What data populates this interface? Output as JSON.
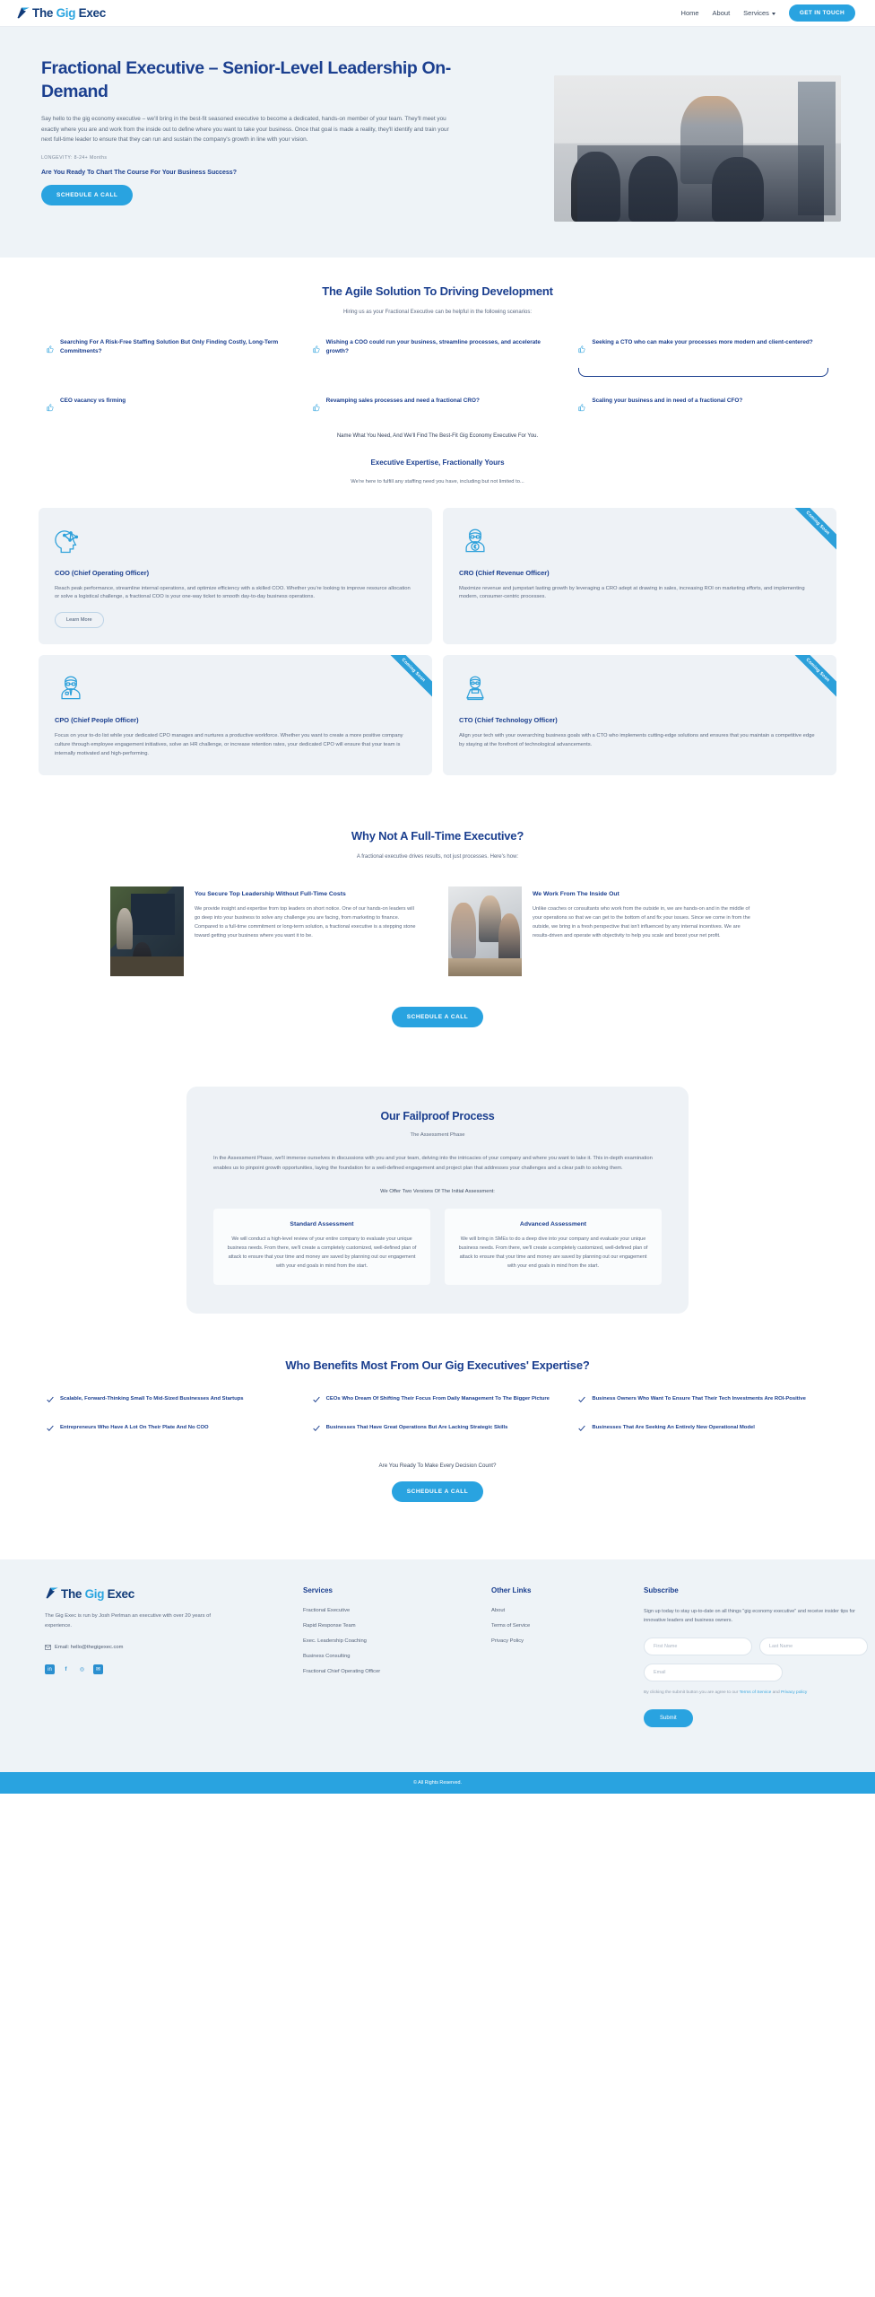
{
  "header": {
    "logo": {
      "part1": "The ",
      "part2": "Gig ",
      "part3": "Exec"
    },
    "nav": [
      {
        "label": "Home"
      },
      {
        "label": "About"
      },
      {
        "label": "Services"
      }
    ],
    "cta_label": "GET IN TOUCH"
  },
  "hero": {
    "title": "Fractional Executive – Senior-Level Leadership On-Demand",
    "paragraph": "Say hello to the gig economy executive – we'll bring in the best-fit seasoned executive to become a dedicated, hands-on member of your team. They'll meet you exactly where you are and work from the inside out to define where you want to take your business. Once that goal is made a reality, they'll identify and train your next full-time leader to ensure that they can run and sustain the company's growth in line with your vision.",
    "longevity": "LONGEVITY: 8-24+ Months",
    "cta_question": "Are You Ready To Chart The Course For Your Business Success?",
    "cta_label": "SCHEDULE A CALL"
  },
  "agile": {
    "title": "The Agile Solution To Driving Development",
    "subtitle": "Hiring us as your Fractional Executive can be helpful in the following scenarios:",
    "scenarios": [
      "Searching For A Risk-Free Staffing Solution But Only Finding Costly, Long-Term Commitments?",
      "Wishing a COO could run your business, streamline processes, and accelerate growth?",
      "Seeking a CTO who can make your processes more modern and client-centered?",
      "CEO vacancy vs firming",
      "Revamping sales processes and need a fractional CRO?",
      "Scaling your business and in need of a fractional CFO?"
    ],
    "tagline": "Name What You Need, And We'll Find The Best-Fit Gig Economy Executive For You.",
    "tagline2": "Executive Expertise, Fractionally Yours",
    "tagline3": "We're here to fulfill any staffing need you have, including but not limited to..."
  },
  "exec_cards": [
    {
      "icon": "head-network-icon",
      "title": "COO (Chief Operating Officer)",
      "desc": "Reach peak performance, streamline internal operations, and optimize efficiency with a skilled COO. Whether you're looking to improve resource allocation or solve a logistical challenge, a fractional COO is your one-way ticket to smooth day-to-day business operations.",
      "button": "Learn More",
      "ribbon": ""
    },
    {
      "icon": "person-revenue-icon",
      "title": "CRO (Chief Revenue Officer)",
      "desc": "Maximize revenue and jumpstart lasting growth by leveraging a CRO adept at drawing in sales, increasing ROI on marketing efforts, and implementing modern, consumer-centric processes.",
      "button": "",
      "ribbon": "Coming Soon"
    },
    {
      "icon": "person-tie-icon",
      "title": "CPO (Chief People Officer)",
      "desc": "Focus on your to-do list while your dedicated CPO manages and nurtures a productive workforce. Whether you want to create a more positive company culture through employee engagement initiatives, solve an HR challenge, or increase retention rates, your dedicated CPO will ensure that your team is internally motivated and high-performing.",
      "button": "",
      "ribbon": "Coming Soon"
    },
    {
      "icon": "person-laptop-icon",
      "title": "CTO (Chief Technology Officer)",
      "desc": "Align your tech with your overarching business goals with a CTO who implements cutting-edge solutions and ensures that you maintain a competitive edge by staying at the forefront of technological advancements.",
      "button": "",
      "ribbon": "Coming Soon"
    }
  ],
  "why": {
    "title": "Why Not A Full-Time Executive?",
    "subtitle": "A fractional executive drives results, not just processes. Here's how:",
    "items": [
      {
        "title": "You Secure Top Leadership Without Full-Time Costs",
        "text": "We provide insight and expertise from top leaders on short notice. One of our hands-on leaders will go deep into your business to solve any challenge you are facing, from marketing to finance. Compared to a full-time commitment or long-term solution, a fractional executive is a stepping stone toward getting your business where you want it to be."
      },
      {
        "title": "We Work From The Inside Out",
        "text": "Unlike coaches or consultants who work from the outside in, we are hands-on and in the middle of your operations so that we can get to the bottom of and fix your issues. Since we come in from the outside, we bring in a fresh perspective that isn't influenced by any internal incentives. We are results-driven and operate with objectivity to help you scale and boost your net profit."
      }
    ],
    "cta_label": "SCHEDULE A CALL"
  },
  "process": {
    "title": "Our Failproof Process",
    "subtitle": "The Assessment Phase",
    "paragraph": "In the Assessment Phase, we'll immerse ourselves in discussions with you and your team, delving into the intricacies of your company and where you want to take it. This in-depth examination enables us to pinpoint growth opportunities, laying the foundation for a well-defined engagement and project plan that addresses your challenges and a clear path to solving them.",
    "offer": "We Offer Two Versions Of The Initial Assessment:",
    "assessments": [
      {
        "title": "Standard Assessment",
        "text": "We will conduct a high-level review of your entire company to evaluate your unique business needs. From there, we'll create a completely customized, well-defined plan of attack to ensure that your time and money are saved by planning out our engagement with your end goals in mind from the start."
      },
      {
        "title": "Advanced Assessment",
        "text": "We will bring in SMEs to do a deep dive into your company and evaluate your unique business needs. From there, we'll create a completely customized, well-defined plan of attack to ensure that your time and money are saved by planning out our engagement with your end goals in mind from the start."
      }
    ]
  },
  "benefits": {
    "title": "Who Benefits Most From Our Gig Executives' Expertise?",
    "items": [
      "Scalable, Forward-Thinking Small To Mid-Sized Businesses And Startups",
      "CEOs Who Dream Of Shifting Their Focus From Daily Management To The Bigger Picture",
      "Business Owners Who Want To Ensure That Their Tech Investments Are ROI-Positive",
      "Entrepreneurs Who Have A Lot On Their Plate And No COO",
      "Businesses That Have Great Operations But Are Lacking Strategic Skills",
      "Businesses That Are Seeking An Entirely New Operational Model"
    ],
    "question": "Are You Ready To Make Every Decision Count?",
    "cta_label": "SCHEDULE A CALL"
  },
  "footer": {
    "logo": {
      "part1": "The ",
      "part2": "Gig ",
      "part3": "Exec"
    },
    "about": "The Gig Exec is run by Josh Perlman an executive with over 20 years of experience.",
    "email_label": "Email: hello@thegigexec.com",
    "social": [
      {
        "name": "linkedin-icon",
        "glyph": "in"
      },
      {
        "name": "facebook-icon",
        "glyph": "f"
      },
      {
        "name": "instagram-icon",
        "glyph": "◎"
      },
      {
        "name": "email-icon",
        "glyph": "✉"
      }
    ],
    "services": {
      "heading": "Services",
      "links": [
        "Fractional Executive",
        "Rapid Response Team",
        "Exec. Leadership Coaching",
        "Business Consulting",
        "Fractional Chief Operating Officer"
      ]
    },
    "other": {
      "heading": "Other Links",
      "links": [
        "About",
        "Terms of Service",
        "Privacy Policy"
      ]
    },
    "subscribe": {
      "heading": "Subscribe",
      "text": "Sign up today to stay up-to-date on all things \"gig economy executive\" and receive insider tips for innovative leaders and business owners.",
      "first_name_placeholder": "First Name",
      "last_name_placeholder": "Last Name",
      "email_placeholder": "Email",
      "terms_pre": "By clicking the submit button you are agree to our ",
      "terms_link1": "Terms of Service",
      "terms_mid": " and ",
      "terms_link2": "Privacy policy",
      "submit_label": "Submit"
    },
    "copyright": "© All Rights Reserved."
  },
  "colors": {
    "accent": "#29a3e0",
    "navy": "#1b3f8f",
    "panel": "#eef2f6"
  }
}
